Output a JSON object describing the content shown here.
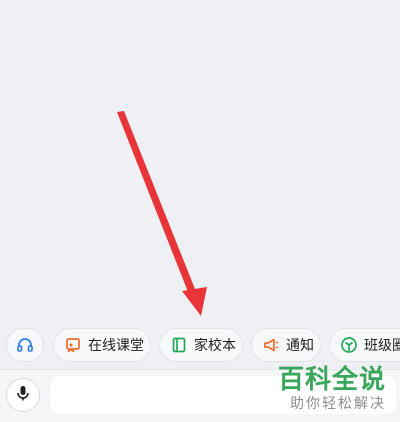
{
  "quick_actions": {
    "service": {
      "icon": "headset-icon"
    },
    "items": [
      {
        "label": "在线课堂",
        "icon": "online-class-icon",
        "color": "#f06a2a"
      },
      {
        "label": "家校本",
        "icon": "homework-book-icon",
        "color": "#20a85a"
      },
      {
        "label": "通知",
        "icon": "megaphone-icon",
        "color": "#f06a2a"
      },
      {
        "label": "班级圈",
        "icon": "class-circle-icon",
        "color": "#20a85a"
      }
    ]
  },
  "input_bar": {
    "mic_icon": "microphone-icon",
    "message_placeholder": ""
  },
  "watermark": {
    "title": "百科全说",
    "subtitle": "助你轻松解决"
  },
  "colors": {
    "background": "#eef0f3",
    "arrow": "#e8353a",
    "accent_blue": "#2f7de1",
    "watermark_green": "#3aa65b"
  }
}
